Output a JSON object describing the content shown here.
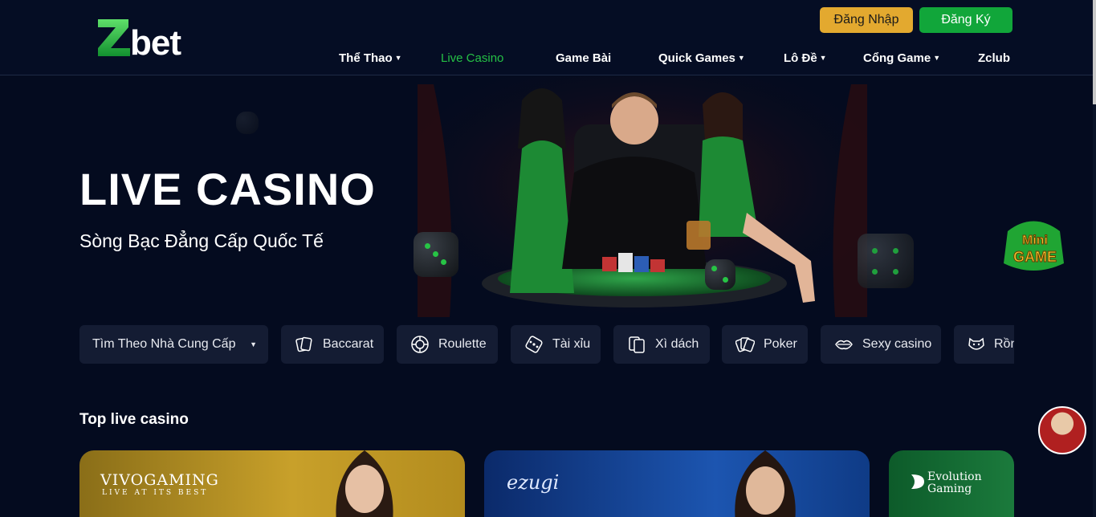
{
  "header": {
    "logo_text": "Zbet",
    "login_label": "Đăng Nhập",
    "register_label": "Đăng Ký",
    "nav": [
      {
        "label": "Thể Thao",
        "dropdown": true
      },
      {
        "label": "Live Casino",
        "dropdown": false,
        "active": true
      },
      {
        "label": "Game Bài",
        "dropdown": false
      },
      {
        "label": "Quick Games",
        "dropdown": true
      },
      {
        "label": "Lô Đề",
        "dropdown": true
      },
      {
        "label": "Cổng Game",
        "dropdown": true
      },
      {
        "label": "Zclub",
        "dropdown": false
      }
    ]
  },
  "hero": {
    "title": "LIVE CASINO",
    "subtitle": "Sòng Bạc Đẳng Cấp Quốc Tế"
  },
  "floating": {
    "minigame_line1": "Mini",
    "minigame_line2": "GAME"
  },
  "filters": {
    "provider_label": "Tìm Theo Nhà Cung Cấp",
    "items": [
      {
        "label": "Baccarat",
        "icon": "cards-icon"
      },
      {
        "label": "Roulette",
        "icon": "roulette-icon"
      },
      {
        "label": "Tài xỉu",
        "icon": "dice-icon"
      },
      {
        "label": "Xì dách",
        "icon": "blackjack-icon"
      },
      {
        "label": "Poker",
        "icon": "poker-icon"
      },
      {
        "label": "Sexy casino",
        "icon": "lips-icon"
      },
      {
        "label": "Rồng",
        "icon": "tiger-icon"
      }
    ]
  },
  "section": {
    "title": "Top live casino"
  },
  "cards": {
    "vivo_brand": "VIVOGAMING",
    "vivo_tagline": "LIVE AT ITS BEST",
    "ezugi_brand": "ezugi",
    "evo_line1": "Evolution",
    "evo_line2": "Gaming"
  },
  "colors": {
    "accent_green": "#25c045",
    "login_bg": "#e3a92f",
    "register_bg": "#11a63a",
    "page_bg": "#040b1f"
  }
}
